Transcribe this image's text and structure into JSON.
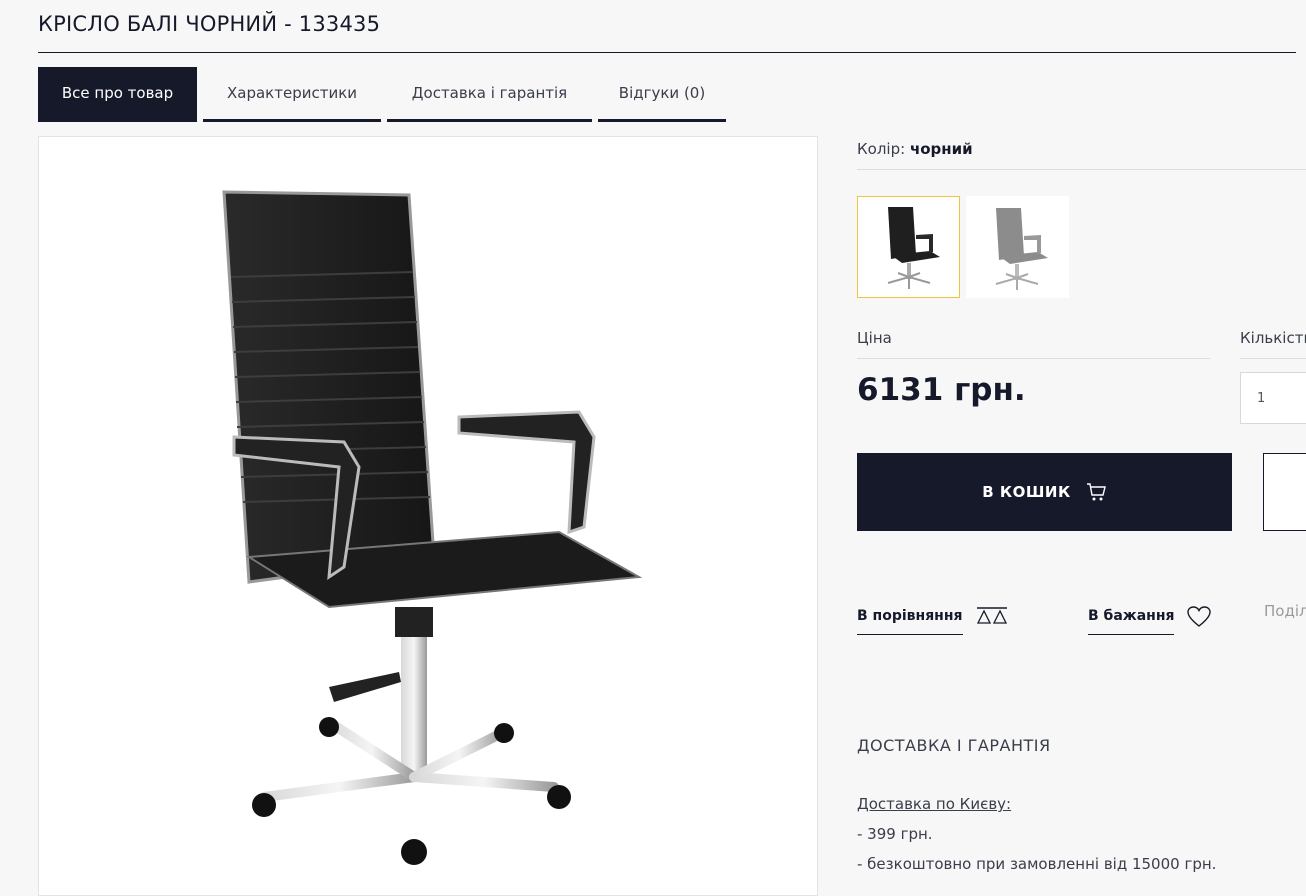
{
  "product": {
    "title": "КРІСЛО БАЛІ ЧОРНИЙ - 133435",
    "color_label": "Колір:",
    "color_value": "чорний",
    "price_label": "Ціна",
    "price": "6131 грн.",
    "qty_label": "Кількість",
    "qty_value": "1"
  },
  "tabs": [
    {
      "label": "Все про товар",
      "active": true
    },
    {
      "label": "Характеристики",
      "active": false
    },
    {
      "label": "Доставка і гарантія",
      "active": false
    },
    {
      "label": "Відгуки (0)",
      "active": false
    }
  ],
  "swatches": [
    {
      "color": "#1f1f1f",
      "selected": true
    },
    {
      "color": "#8c8c8c",
      "selected": false
    }
  ],
  "actions": {
    "cart_label": "В КОШИК",
    "compare_label": "В порівняння",
    "wishlist_label": "В бажання",
    "share_label": "Поділитися"
  },
  "delivery": {
    "heading": "ДОСТАВКА І ГАРАНТІЯ",
    "link": "Доставка по Києву:",
    "lines": [
      "- 399 грн.",
      "- безкоштовно при замовленні від 15000 грн."
    ]
  },
  "colors": {
    "primary": "#16192a",
    "swatch_selected_border": "#f0c340",
    "background": "#f7f7f7"
  }
}
